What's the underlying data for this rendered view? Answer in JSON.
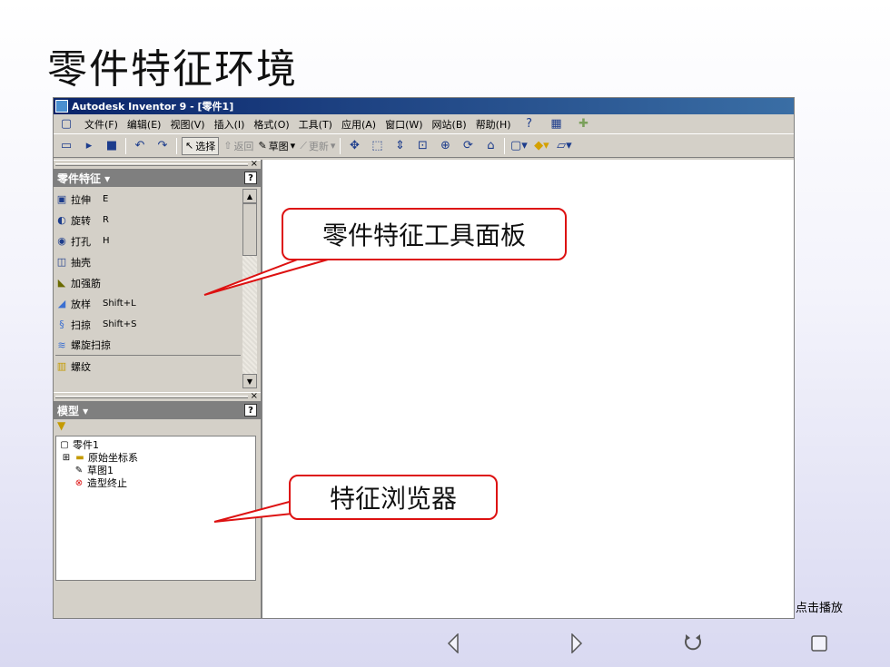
{
  "slide": {
    "title": "零件特征环境"
  },
  "window": {
    "title": "Autodesk Inventor 9 - [零件1]"
  },
  "menubar": {
    "items": [
      "文件(F)",
      "编辑(E)",
      "视图(V)",
      "插入(I)",
      "格式(O)",
      "工具(T)",
      "应用(A)",
      "窗口(W)",
      "网站(B)",
      "帮助(H)"
    ]
  },
  "toolbar": {
    "select_label": "选择",
    "return_label": "返回",
    "sketch_label": "草图",
    "update_label": "更新"
  },
  "feature_panel": {
    "title": "零件特征 ▾",
    "items": [
      {
        "label": "拉伸",
        "shortcut": "E"
      },
      {
        "label": "旋转",
        "shortcut": "R"
      },
      {
        "label": "打孔",
        "shortcut": "H"
      },
      {
        "label": "抽壳",
        "shortcut": ""
      },
      {
        "label": "加强筋",
        "shortcut": ""
      },
      {
        "label": "放样",
        "shortcut": "Shift+L"
      },
      {
        "label": "扫掠",
        "shortcut": "Shift+S"
      },
      {
        "label": "螺旋扫掠",
        "shortcut": ""
      },
      {
        "label": "螺纹",
        "shortcut": ""
      }
    ]
  },
  "model_panel": {
    "title": "模型 ▾",
    "tree": [
      {
        "label": "零件1"
      },
      {
        "label": "原始坐标系"
      },
      {
        "label": "草图1"
      },
      {
        "label": "造型终止"
      }
    ]
  },
  "callouts": {
    "feature_tools": "零件特征工具面板",
    "browser": "特征浏览器"
  },
  "play_hint": "点击播放",
  "colors": {
    "title_bar": "#0a246a",
    "callout_border": "#dd1111",
    "panel_header": "#7f7f7f"
  }
}
